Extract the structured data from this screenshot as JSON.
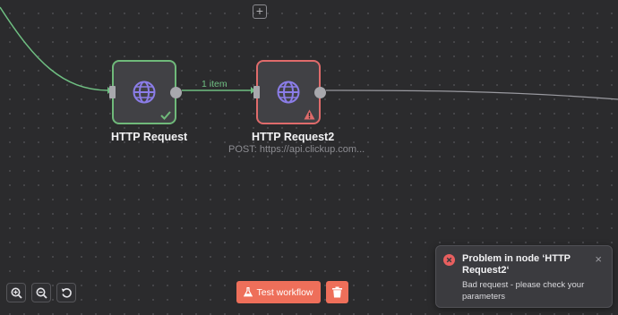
{
  "canvas": {
    "add_symbol": "+"
  },
  "nodes": [
    {
      "title": "HTTP Request",
      "subtitle": "",
      "status": "success"
    },
    {
      "title": "HTTP Request2",
      "subtitle": "POST: https://api.clickup.com...",
      "status": "error"
    }
  ],
  "connection": {
    "label": "1 item"
  },
  "toolbar": {
    "test_workflow_label": "Test workflow"
  },
  "toast": {
    "title": "Problem in node ‘HTTP Request2‘",
    "message": "Bad request - please check your parameters",
    "close_symbol": "×"
  },
  "colors": {
    "success": "#6fb97a",
    "error": "#e06b6b",
    "accent": "#ee6f5a",
    "globe": "#8b7de8"
  },
  "icons": {
    "node_icon": "globe-icon",
    "zoom_in": "zoom-in-icon",
    "zoom_out": "zoom-out-icon",
    "reset": "reset-icon",
    "delete": "trash-icon",
    "test": "flask-icon"
  }
}
